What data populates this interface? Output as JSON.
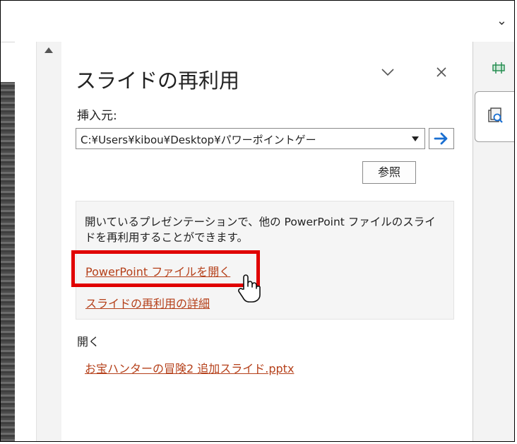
{
  "panel": {
    "title": "スライドの再利用",
    "insert_from_label": "挿入元:",
    "path_value": "C:¥Users¥kibou¥Desktop¥パワーポイントゲー",
    "browse_label": "参照",
    "info_text": "開いているプレゼンテーションで、他の PowerPoint ファイルのスライドを再利用することができます。",
    "open_file_link": "PowerPoint ファイルを開く",
    "details_link": "スライドの再利用の詳細",
    "open_section_label": "開く",
    "recent_file": "お宝ハンターの冒険2 追加スライド.pptx"
  },
  "icons": {
    "topbar_chevron": "chevron-down-icon",
    "pane_options": "chevron-down-icon",
    "close": "close-icon",
    "go": "arrow-right-icon",
    "scroll_up": "scroll-up-arrow-icon",
    "rail_top": "guides-icon",
    "rail_tab": "reuse-slides-icon",
    "cursor": "hand-pointer-icon"
  },
  "colors": {
    "link": "#b5401a",
    "highlight": "#e00000",
    "go_arrow": "#1a6fd1"
  }
}
